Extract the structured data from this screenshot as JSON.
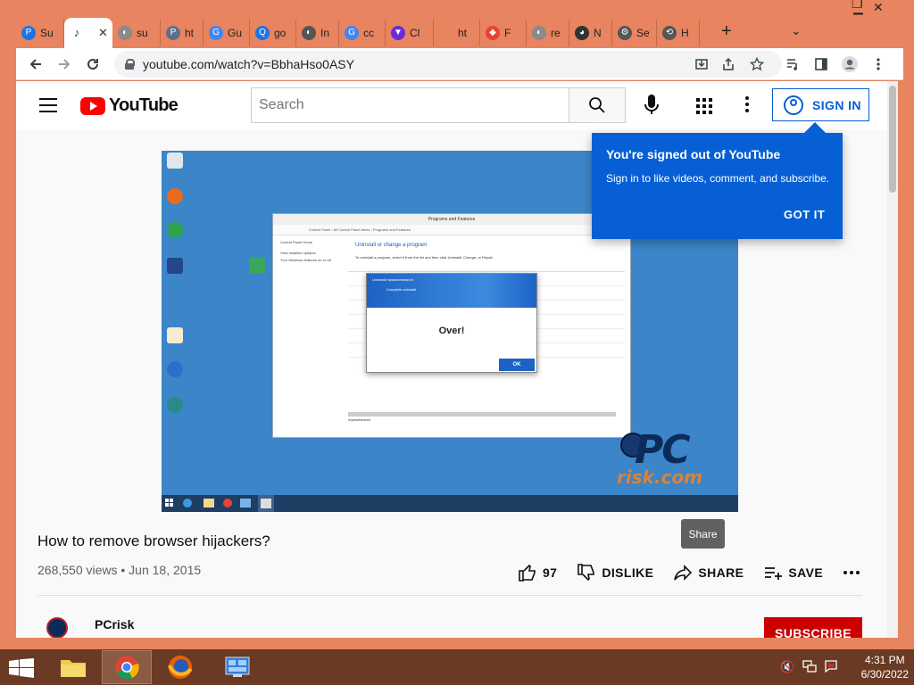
{
  "browser": {
    "tabs": [
      {
        "label": "Su",
        "color": "#1a73e8",
        "glyph": "P"
      },
      {
        "label": "",
        "active": true,
        "color": "#333333",
        "glyph": "♪"
      },
      {
        "label": "su",
        "color": "#8a8a8a",
        "glyph": "◐"
      },
      {
        "label": "ht",
        "color": "#5f6f8a",
        "glyph": "P"
      },
      {
        "label": "Gu",
        "color": "#4285f4",
        "glyph": "G"
      },
      {
        "label": "go",
        "color": "#1a73e8",
        "glyph": "Q"
      },
      {
        "label": "In",
        "color": "#555555",
        "glyph": "◐"
      },
      {
        "label": "cc",
        "color": "#4285f4",
        "glyph": "G"
      },
      {
        "label": "Cl",
        "color": "#6a2bd9",
        "glyph": "▼"
      },
      {
        "label": "ht",
        "color": "#e8845f",
        "glyph": ""
      },
      {
        "label": "F",
        "color": "#e94235",
        "glyph": "◆"
      },
      {
        "label": "re",
        "color": "#8a8a8a",
        "glyph": "◐"
      },
      {
        "label": "N",
        "color": "#333333",
        "glyph": "◕"
      },
      {
        "label": "Se",
        "color": "#555555",
        "glyph": "⚙"
      },
      {
        "label": "H",
        "color": "#555555",
        "glyph": "⟲"
      }
    ],
    "new_tab": "+",
    "tab_search": "⌄",
    "url": "youtube.com/watch?v=BbhaHso0ASY"
  },
  "youtube": {
    "logo_text": "YouTube",
    "search_placeholder": "Search",
    "signin_label": "SIGN IN",
    "popup": {
      "title": "You're signed out of YouTube",
      "text": "Sign in to like videos, comment, and subscribe.",
      "button": "GOT IT"
    },
    "tooltip": "Share",
    "video": {
      "title": "How to remove browser hijackers?",
      "meta": "268,550 views • Jun 18, 2015",
      "likes": "97",
      "dislike_label": "DISLIKE",
      "share_label": "SHARE",
      "save_label": "SAVE"
    },
    "channel": {
      "name": "PCrisk",
      "subscribe": "SUBSCRIBE"
    },
    "player": {
      "window_title": "Programs and Features",
      "breadcrumb": "Control Panel  ›  All Control Panel Items  ›  Programs and Features",
      "side_items": [
        "Control Panel Home",
        "View installed updates",
        "Turn Windows features on or off"
      ],
      "heading": "Uninstall or change a program",
      "instructions": "To uninstall a program, select it from the list and then click Uninstall, Change, or Repair.",
      "dialog_title": "Uninstall mysearchsearch",
      "dialog_sub": "Complete uninstall",
      "dialog_message": "Over!",
      "dialog_ok": "OK",
      "bottom_item": "mystartsearch",
      "watermark_pc": "PC",
      "watermark_risk": "risk.com"
    }
  },
  "taskbar": {
    "time": "4:31 PM",
    "date": "6/30/2022"
  }
}
